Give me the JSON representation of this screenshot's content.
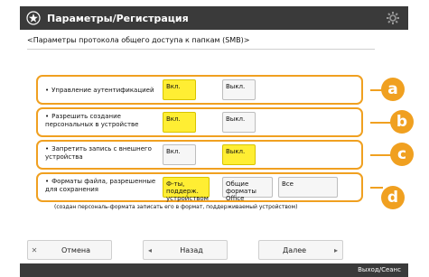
{
  "header": {
    "title": "Параметры/Регистрация",
    "logo_icon": "settings-star-icon",
    "gear_icon": "gear-icon"
  },
  "subtitle": "<Параметры протокола общего доступа к папкам (SMB)>",
  "rows": [
    {
      "label": "Управление аутентификацией",
      "options": [
        {
          "label": "Вкл.",
          "selected": true
        },
        {
          "label": "Выкл.",
          "selected": false
        }
      ],
      "callout": "a"
    },
    {
      "label": "Разрешить создание персональных в устройстве",
      "options": [
        {
          "label": "Вкл.",
          "selected": true
        },
        {
          "label": "Выкл.",
          "selected": false
        }
      ],
      "callout": "b"
    },
    {
      "label": "Запретить запись с внешнего устройства",
      "options": [
        {
          "label": "Вкл.",
          "selected": false
        },
        {
          "label": "Выкл.",
          "selected": true
        }
      ],
      "callout": "c"
    },
    {
      "label": "Форматы файла, разрешенные для сохранения",
      "options": [
        {
          "label": "Ф-ты, поддерж. устройством",
          "selected": true
        },
        {
          "label": "Общие форматы Office",
          "selected": false
        },
        {
          "label": "Все",
          "selected": false
        }
      ],
      "callout": "d"
    }
  ],
  "note": "(создан персональ-формата записать его в формат, поддерживаемый устройством)",
  "footer": {
    "cancel": "Отмена",
    "back": "Назад",
    "next": "Далее",
    "status": "Выход/Сеанс"
  },
  "colors": {
    "accent": "#f0a020",
    "selected": "#ffee33",
    "titlebar": "#3a3a3a"
  }
}
